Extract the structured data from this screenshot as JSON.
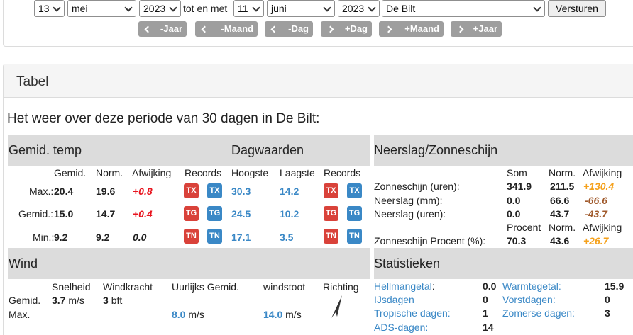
{
  "form": {
    "start_day": "13",
    "start_month": "mei",
    "start_year": "2023",
    "between_label": "tot en met",
    "end_day": "11",
    "end_month": "juni",
    "end_year": "2023",
    "station": "De Bilt",
    "submit_label": "Versturen"
  },
  "nav": {
    "prev_year": "-Jaar",
    "prev_month": "-Maand",
    "prev_day": "-Dag",
    "next_day": "+Dag",
    "next_month": "+Maand",
    "next_year": "+Jaar"
  },
  "panel": {
    "title": "Tabel",
    "period_text": "Het weer over deze periode van 30 dagen in De Bilt:"
  },
  "temp": {
    "section_title": "Gemid. temp",
    "day_section_title": "Dagwaarden",
    "col_avg": "Gemid.",
    "col_norm": "Norm.",
    "col_dev": "Afwijking",
    "col_records": "Records",
    "col_high": "Hoogste",
    "col_low": "Laagste",
    "col_records2": "Records",
    "rows": [
      {
        "label": "Max.:",
        "avg": "20.4",
        "norm": "19.6",
        "dev": "+0.8",
        "badge": "TX",
        "high": "30.3",
        "low": "14.2"
      },
      {
        "label": "Gemid.:",
        "avg": "15.0",
        "norm": "14.7",
        "dev": "+0.4",
        "badge": "TG",
        "high": "24.5",
        "low": "10.2"
      },
      {
        "label": "Min.:",
        "avg": "9.2",
        "norm": "9.2",
        "dev": "0.0",
        "badge": "TN",
        "high": "17.1",
        "low": "3.5"
      }
    ]
  },
  "precip": {
    "section_title": "Neerslag/Zonneschijn",
    "col_sum": "Som",
    "col_norm": "Norm.",
    "col_dev": "Afwijking",
    "col_pct": "Procent",
    "col_norm2": "Norm.",
    "col_dev2": "Afwijking",
    "rows": [
      {
        "label": "Zonneschijn (uren):",
        "sum": "341.9",
        "norm": "211.5",
        "dev": "+130.4"
      },
      {
        "label": "Neerslag (mm):",
        "sum": "0.0",
        "norm": "66.6",
        "dev": "-66.6"
      },
      {
        "label": "Neerslag (uren):",
        "sum": "0.0",
        "norm": "43.7",
        "dev": "-43.7"
      }
    ],
    "pct_row": {
      "label": "Zonneschijn Procent (%):",
      "pct": "70.3",
      "norm": "43.6",
      "dev": "+26.7"
    }
  },
  "wind": {
    "section_title": "Wind",
    "col_speed": "Snelheid",
    "col_force": "Windkracht",
    "col_hourly": "Uurlijks Gemid.",
    "col_gust": "windstoot",
    "col_dir": "Richting",
    "avg_label": "Gemid.",
    "avg_speed": "3.7",
    "avg_speed_unit": "m/s",
    "avg_force": "3",
    "avg_force_unit": "bft",
    "max_label": "Max.",
    "max_hourly": "8.0",
    "max_hourly_unit": "m/s",
    "max_gust": "14.0",
    "max_gust_unit": "m/s"
  },
  "stats": {
    "section_title": "Statistieken",
    "left": [
      {
        "label": "Hellmangetal",
        "suffix": ":",
        "value": "0.0"
      },
      {
        "label": "IJsdagen",
        "suffix": "",
        "value": "0"
      },
      {
        "label": "Tropische dagen:",
        "suffix": "",
        "value": "1"
      },
      {
        "label": "ADS-dagen:",
        "suffix": "",
        "value": "14"
      }
    ],
    "right": [
      {
        "label": "Warmtegetal:",
        "value": "15.9"
      },
      {
        "label": "Vorstdagen:",
        "value": "0"
      },
      {
        "label": "Zomerse dagen:",
        "value": "3"
      }
    ]
  }
}
